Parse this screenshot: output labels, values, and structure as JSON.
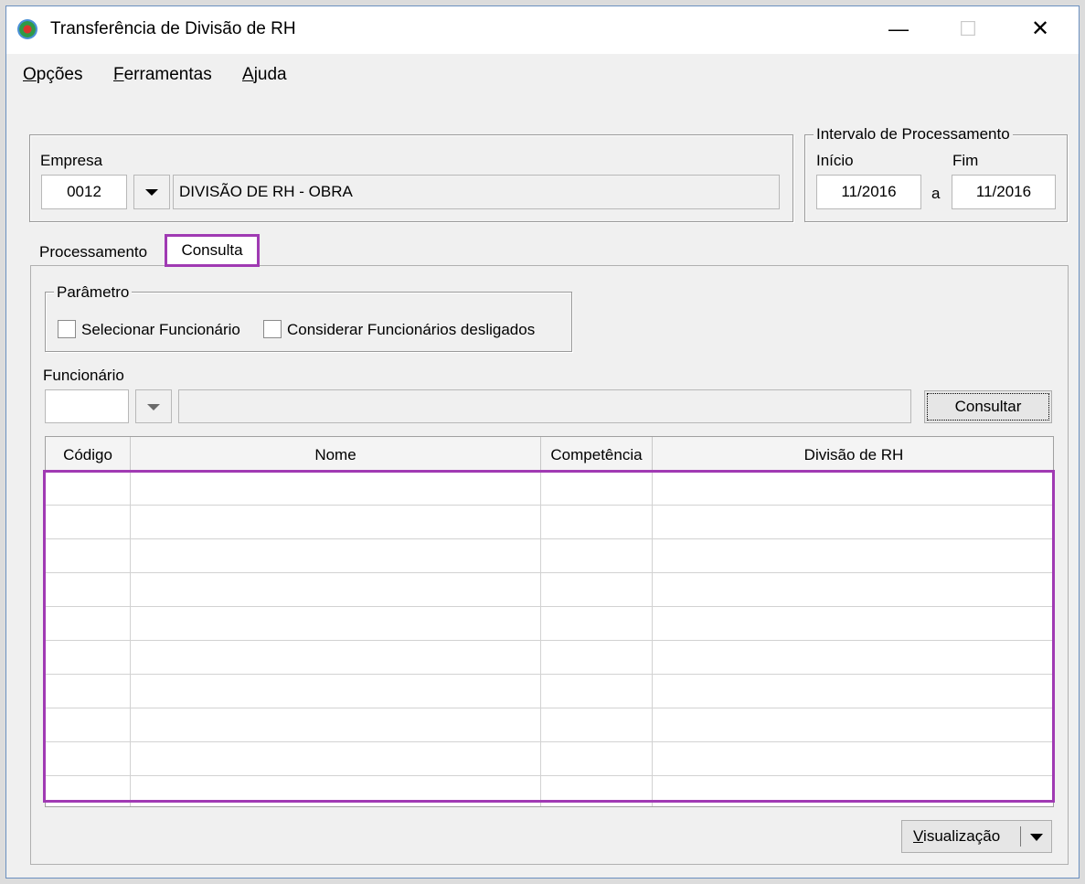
{
  "window": {
    "title": "Transferência de Divisão de RH"
  },
  "menu": [
    {
      "hotkey": "O",
      "rest": "pções"
    },
    {
      "hotkey": "F",
      "rest": "erramentas"
    },
    {
      "hotkey": "A",
      "rest": "juda"
    }
  ],
  "empresa": {
    "label": "Empresa",
    "code": "0012",
    "name": "DIVISÃO DE RH - OBRA"
  },
  "intervalo": {
    "legend": "Intervalo de Processamento",
    "inicio_label": "Início",
    "fim_label": "Fim",
    "inicio": "11/2016",
    "separator": "a",
    "fim": "11/2016"
  },
  "tabs": [
    {
      "label": "Processamento",
      "active": false
    },
    {
      "label": "Consulta",
      "active": true
    }
  ],
  "parametro": {
    "legend": "Parâmetro",
    "options": [
      {
        "label": "Selecionar Funcionário",
        "checked": false
      },
      {
        "label": "Considerar Funcionários desligados",
        "checked": false
      }
    ]
  },
  "funcionario": {
    "label": "Funcionário",
    "code": "",
    "name": ""
  },
  "buttons": {
    "consultar": "Consultar",
    "visualizacao_hotkey": "V",
    "visualizacao_rest": "isualização"
  },
  "grid": {
    "columns": [
      "Código",
      "Nome",
      "Competência",
      "Divisão de RH"
    ],
    "rows": []
  },
  "colors": {
    "highlight": "#a03ab3"
  }
}
